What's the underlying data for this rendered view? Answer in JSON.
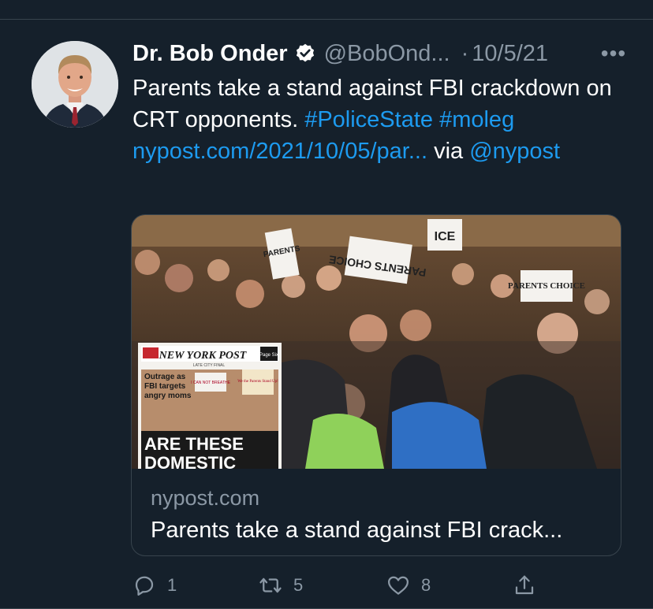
{
  "tweet": {
    "author_name": "Dr. Bob Onder",
    "handle": "@BobOnd...",
    "date": "10/5/21",
    "separator": "·",
    "more_label": "•••",
    "text_plain_1": "Parents take a stand against FBI crackdown on CRT opponents. ",
    "hashtag_1": "#PoliceState",
    "hashtag_2": "#moleg",
    "link": "nypost.com/2021/10/05/par...",
    "via": " via ",
    "mention": "@nypost"
  },
  "card": {
    "domain": "nypost.com",
    "title": "Parents take a stand against FBI crack...",
    "image_signs": {
      "sign_1": "PARENTS CHOICE",
      "sign_2": "PARENTS CHOICE",
      "sign_3": "ICE",
      "sign_4": "PARENTS"
    },
    "cover": {
      "masthead": "NEW YORK POST",
      "badge": "Page Six",
      "sub": "LATE CITY FINAL",
      "headline_1": "Outrage as",
      "headline_2": "FBI targets",
      "headline_3": "angry moms",
      "big_1": "ARE THESE",
      "big_2": "DOMESTIC",
      "sign_a": "We the Parents Stand Up!",
      "sign_b": "I CAN NOT BREATHE"
    }
  },
  "actions": {
    "reply_count": "1",
    "retweet_count": "5",
    "like_count": "8"
  },
  "colors": {
    "background": "#15202b",
    "link": "#1d9bf0",
    "muted": "#8b98a5",
    "border": "#38444d"
  },
  "icons": [
    "verified-badge-icon",
    "more-icon",
    "reply-icon",
    "retweet-icon",
    "like-icon",
    "share-icon"
  ]
}
